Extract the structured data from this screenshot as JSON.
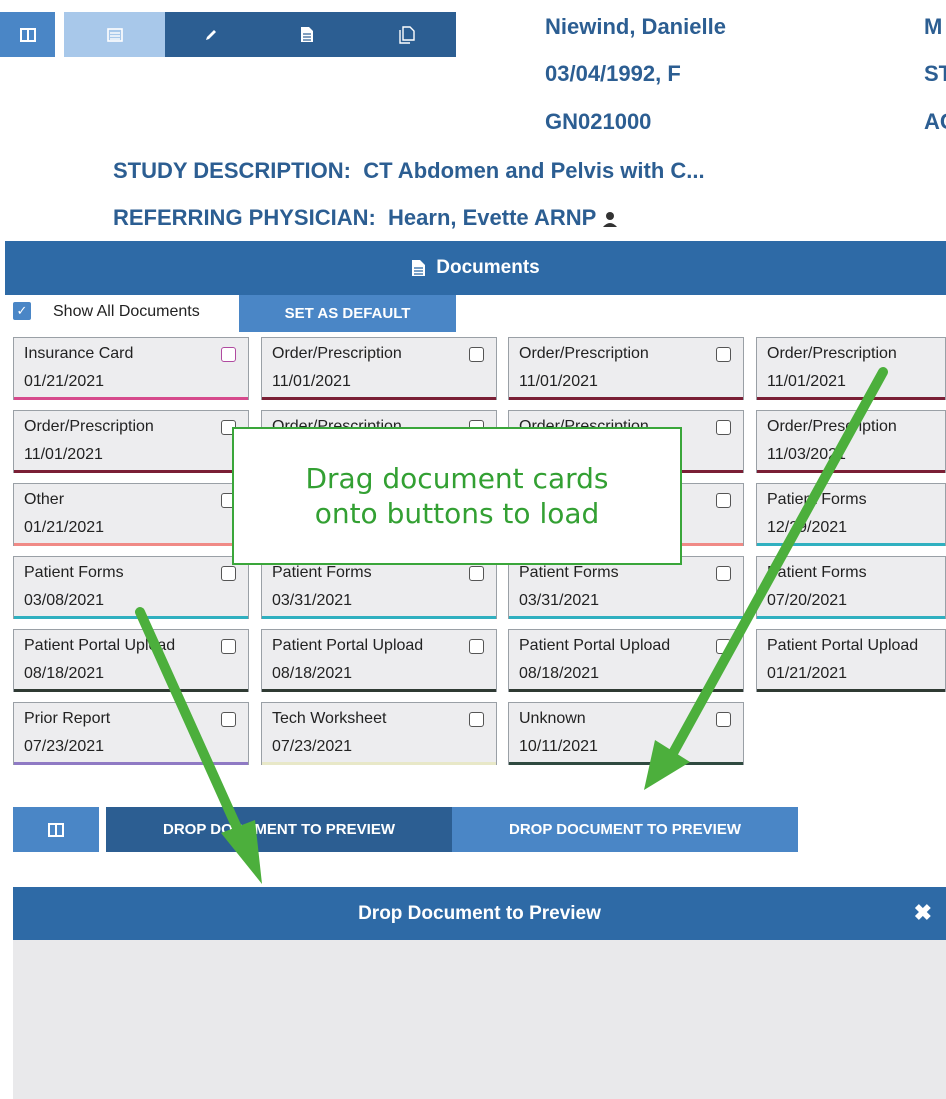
{
  "toolbar": {
    "icons": [
      "split-view-icon",
      "list-icon",
      "pencil-icon",
      "document-icon",
      "documents-copy-icon"
    ]
  },
  "patient": {
    "name": "Niewind, Danielle",
    "dob_sex": "03/04/1992, F",
    "id": "GN021000",
    "right_col": [
      "M",
      "ST",
      "AC"
    ]
  },
  "study": {
    "desc_label": "STUDY DESCRIPTION:",
    "desc_value": "CT Abdomen and Pelvis with C...",
    "ref_label": "REFERRING PHYSICIAN:",
    "ref_value": "Hearn, Evette ARNP"
  },
  "documents": {
    "header": "Documents",
    "show_all_label": "Show All Documents",
    "show_all_checked": true,
    "set_default_label": "SET AS DEFAULT",
    "cards": [
      {
        "title": "Insurance Card",
        "date": "01/21/2021",
        "bar": "#d64a8c",
        "cb": "#b04aa0"
      },
      {
        "title": "Order/Prescription",
        "date": "11/01/2021",
        "bar": "#7a1f35",
        "cb": "#555"
      },
      {
        "title": "Order/Prescription",
        "date": "11/01/2021",
        "bar": "#7a1f35",
        "cb": "#555"
      },
      {
        "title": "Order/Prescription",
        "date": "11/01/2021",
        "bar": "#7a1f35",
        "cb": ""
      },
      {
        "title": "Order/Prescription",
        "date": "11/01/2021",
        "bar": "#7a1f35",
        "cb": "#555"
      },
      {
        "title": "Order/Prescription",
        "date": "",
        "bar": "#7a1f35",
        "cb": "#555"
      },
      {
        "title": "Order/Prescription",
        "date": "",
        "bar": "#7a1f35",
        "cb": "#555"
      },
      {
        "title": "Order/Prescription",
        "date": "11/03/2021",
        "bar": "#7a1f35",
        "cb": ""
      },
      {
        "title": "Other",
        "date": "01/21/2021",
        "bar": "#f08a86",
        "cb": "#555"
      },
      {
        "title": "",
        "date": "",
        "bar": "#f08a86",
        "cb": ""
      },
      {
        "title": "",
        "date": "",
        "bar": "#f08a86",
        "cb": "#555"
      },
      {
        "title": "Patient Forms",
        "date": "12/29/2021",
        "bar": "#30b0c0",
        "cb": ""
      },
      {
        "title": "Patient Forms",
        "date": "03/08/2021",
        "bar": "#30b0c0",
        "cb": "#555"
      },
      {
        "title": "Patient Forms",
        "date": "03/31/2021",
        "bar": "#30b0c0",
        "cb": "#555"
      },
      {
        "title": "Patient Forms",
        "date": "03/31/2021",
        "bar": "#30b0c0",
        "cb": "#555"
      },
      {
        "title": "Patient Forms",
        "date": "07/20/2021",
        "bar": "#30b0c0",
        "cb": ""
      },
      {
        "title": "Patient Portal Upload",
        "date": "08/18/2021",
        "bar": "#2f3a33",
        "cb": "#555"
      },
      {
        "title": "Patient Portal Upload",
        "date": "08/18/2021",
        "bar": "#2f3a33",
        "cb": "#555"
      },
      {
        "title": "Patient Portal Upload",
        "date": "08/18/2021",
        "bar": "#2f3a33",
        "cb": "#555"
      },
      {
        "title": "Patient Portal Upload",
        "date": "01/21/2021",
        "bar": "#2f3a33",
        "cb": ""
      },
      {
        "title": "Prior Report",
        "date": "07/23/2021",
        "bar": "#8f7ac4",
        "cb": "#555"
      },
      {
        "title": "Tech Worksheet",
        "date": "07/23/2021",
        "bar": "#e8e8c8",
        "cb": "#555"
      },
      {
        "title": "Unknown",
        "date": "10/11/2021",
        "bar": "#2f4a40",
        "cb": "#555"
      }
    ]
  },
  "tooltip": {
    "line1": "Drag document cards",
    "line2": "onto buttons to load"
  },
  "drop_buttons": {
    "left_label": "DROP DOCUMENT TO PREVIEW",
    "right_label": "DROP DOCUMENT TO PREVIEW"
  },
  "preview": {
    "title": "Drop Document to Preview",
    "close_icon": "close-icon"
  },
  "colors": {
    "primary_dark": "#2c5e92",
    "primary_mid": "#4a86c6",
    "primary_light": "#a8c8ea",
    "annotation_green": "#3aa63a"
  }
}
